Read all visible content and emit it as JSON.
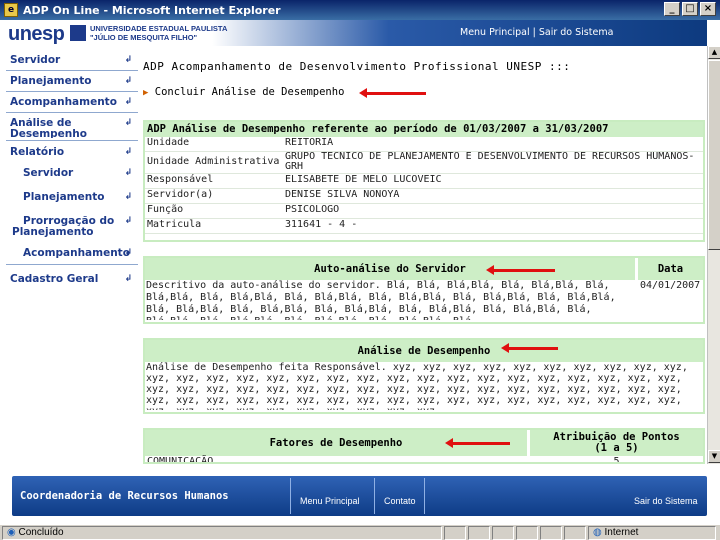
{
  "window": {
    "title": "ADP On Line - Microsoft Internet Explorer"
  },
  "header": {
    "logo": "unesp",
    "university_line1": "UNIVERSIDADE ESTADUAL PAULISTA",
    "university_line2": "\"JÚLIO DE MESQUITA FILHO\"",
    "nav_menu": "Menu Principal",
    "nav_sep": "|",
    "nav_exit": "Sair do Sistema"
  },
  "sidebar": {
    "items": [
      {
        "label": "Servidor"
      },
      {
        "label": "Planejamento"
      },
      {
        "label": "Acompanhamento"
      },
      {
        "label": "Análise de Desempenho"
      },
      {
        "label": "Relatório"
      },
      {
        "label": "Servidor"
      },
      {
        "label": "Planejamento"
      },
      {
        "label": "Prorrogação do Planejamento"
      },
      {
        "label": "Acompanhamento"
      },
      {
        "label": "Cadastro Geral"
      }
    ]
  },
  "main": {
    "title": "ADP   Acompanhamento de Desenvolvimento Profissional UNESP :::",
    "subtitle": "Concluir Análise de Desempenho",
    "period_header": "ADP   Análise de Desempenho referente ao período de 01/03/2007 a 31/03/2007",
    "info": [
      {
        "key": "Unidade",
        "value": "REITORIA"
      },
      {
        "key": "Unidade Administrativa",
        "value": "GRUPO TÉCNICO DE PLANEJAMENTO E DESENVOLVIMENTO DE RECURSOS HUMANOS-GRH"
      },
      {
        "key": "Responsável",
        "value": "ELISABETE DE MELO LUCOVEIC"
      },
      {
        "key": "Servidor(a)",
        "value": "DENISE SILVA NONOYA"
      },
      {
        "key": "Função",
        "value": "PSICOLOGO"
      },
      {
        "key": "Matricula",
        "value": "311641 - 4 -"
      }
    ],
    "autoanalise": {
      "header": "Auto-análise do Servidor",
      "date_header": "Data",
      "text": "Descritivo da auto-análise do servidor. Blá, Blá, Blá,Blá, Blá, Blá,Blá, Blá, Blá,Blá, Blá, Blá,Blá, Blá, Blá,Blá, Blá, Blá,Blá, Blá, Blá,Blá, Blá, Blá,Blá, Blá, Blá,Blá, Blá, Blá,Blá, Blá, Blá,Blá, Blá, Blá,Blá, Blá, Blá,Blá, Blá, Blá,Blá, Blá, Blá,Blá, Blá, Blá,Blá, Blá, Blá,Blá, Blá.",
      "date": "04/01/2007"
    },
    "analise": {
      "header": "Análise de Desempenho",
      "text": "Análise de Desempenho feita Responsável. xyz, xyz, xyz, xyz, xyz, xyz, xyz, xyz, xyz, xyz, xyz, xyz, xyz, xyz, xyz, xyz, xyz, xyz, xyz, xyz, xyz, xyz, xyz, xyz, xyz, xyz, xyz, xyz, xyz, xyz, xyz, xyz, xyz, xyz, xyz, xyz, xyz, xyz, xyz, xyz, xyz, xyz, xyz, xyz, xyz, xyz, xyz, xyz, xyz, xyz, xyz, xyz, xyz, xyz, xyz, xyz, xyz, xyz, xyz, xyz, xyz, xyz, xyz, xyz, xyz, xyz, xyz, xyz, xyz, xyz, xyz, xyz, xyz, xyz."
    },
    "fatores": {
      "header": "Fatores de Desempenho",
      "points_header_1": "Atribuição de Pontos",
      "points_header_2": "(1 a 5)",
      "first_row": "COMUNICAÇÃO",
      "first_points": "5"
    }
  },
  "footer": {
    "title": "Coordenadoria de Recursos Humanos",
    "link_menu": "Menu Principal",
    "link_contato": "Contato",
    "link_exit": "Sair do Sistema"
  },
  "statusbar": {
    "status": "Concluído",
    "zone": "Internet"
  },
  "colors": {
    "brand_blue": "#1d3a8a",
    "box_green": "#cdeec6",
    "annotation_red": "#e01010"
  }
}
